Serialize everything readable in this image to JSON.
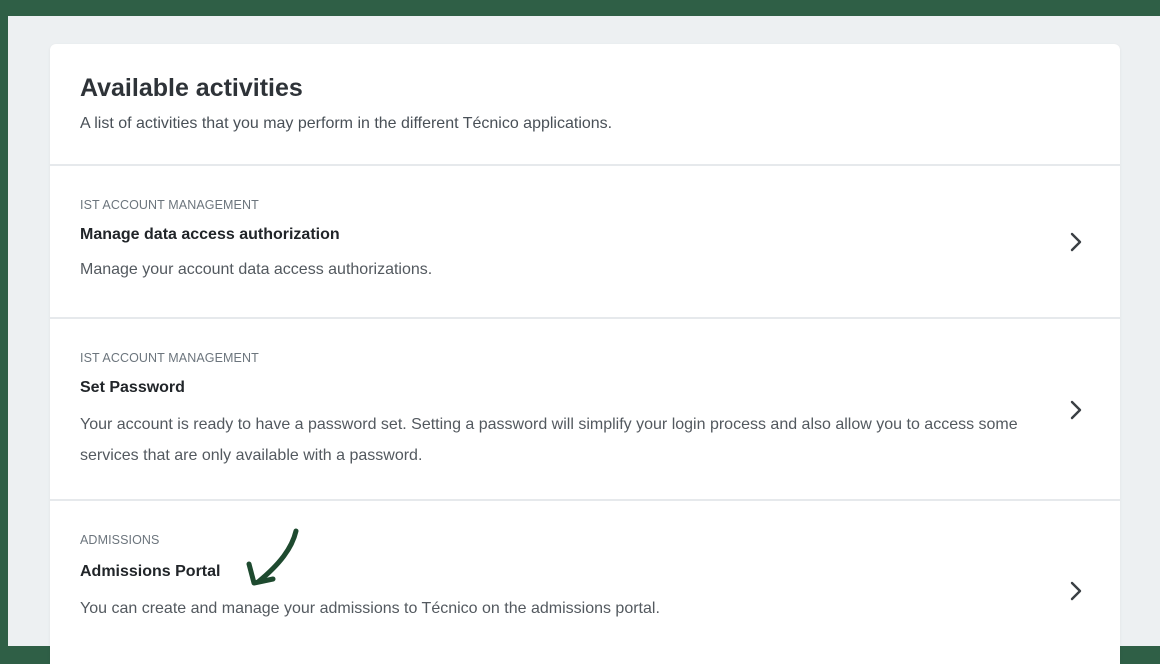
{
  "header": {
    "title": "Available activities",
    "subtitle": "A list of activities that you may perform in the different Técnico applications."
  },
  "activities": [
    {
      "category": "IST ACCOUNT MANAGEMENT",
      "title": "Manage data access authorization",
      "description": "Manage your account data access authorizations."
    },
    {
      "category": "IST ACCOUNT MANAGEMENT",
      "title": "Set Password",
      "description": "Your account is ready to have a password set. Setting a password will simplify your login process and also allow you to access some services that are only available with a password."
    },
    {
      "category": "ADMISSIONS",
      "title": "Admissions Portal",
      "description": "You can create and manage your admissions to Técnico on the admissions portal."
    }
  ],
  "icons": {
    "chevron": "chevron-right-icon",
    "annotation": "curved-arrow-icon"
  },
  "colors": {
    "frame": "#2f5f46",
    "annotation_arrow": "#1e4a2f"
  }
}
